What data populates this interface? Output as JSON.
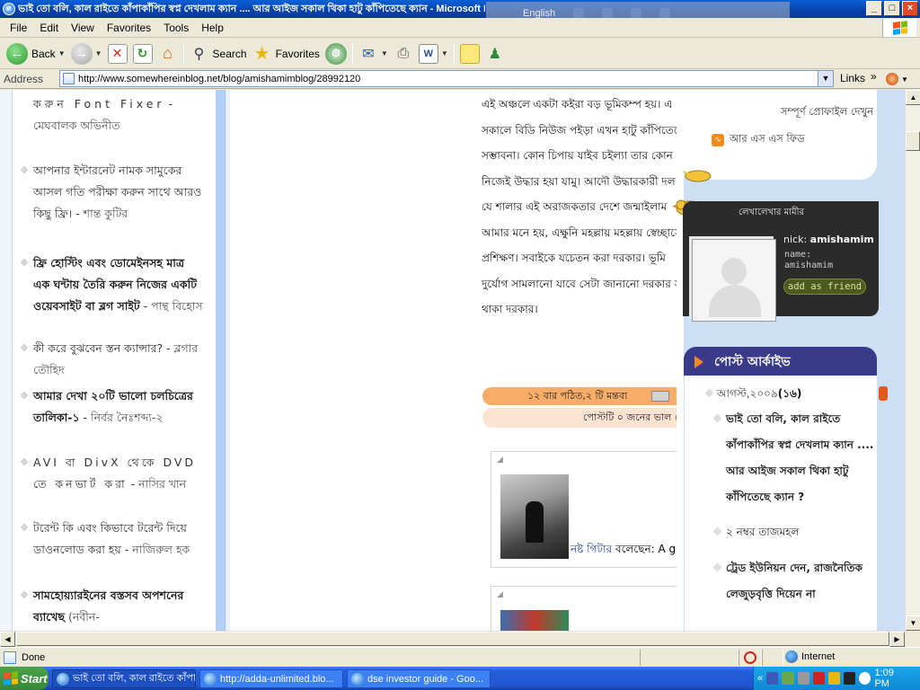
{
  "window": {
    "title": "ভাই তো বলি, কাল রাইতে কাঁপাকাঁপির স্বপ্ন দেখলাম ক্যান .... আর আইজ সকাল থিকা হাটু কাঁপিতেছে ক্যান - Microsoft Internet Explorer",
    "lang_indicator": "English",
    "buttons": {
      "minimize": "_",
      "maximize": "□",
      "close": "×"
    }
  },
  "menu": [
    "File",
    "Edit",
    "View",
    "Favorites",
    "Tools",
    "Help"
  ],
  "toolbar": {
    "back": "Back",
    "search": "Search",
    "favorites": "Favorites"
  },
  "address": {
    "label": "Address",
    "url": "http://www.somewhereinblog.net/blog/amishamimblog/28992120",
    "links": "Links"
  },
  "left_sidebar": [
    {
      "title": "করুন Font Fixer",
      "author": "মেঘবালক অভিনীত",
      "bold": false
    },
    {
      "title": "আপনার ইন্টারনেট নামক সামুকের আসল গতি পরীক্ষা করুন সাথে আরও কিছু ফ্রি।",
      "author": "শান্ত কুটির",
      "bold": false
    },
    {
      "title": "ফ্রি হোস্টিং এবং ডোমেইনসহ মাত্র এক ঘন্টায় তৈরি করুন নিজের একটি ওয়েবসাইট বা ব্লগ সাইট",
      "author": "পান্থ বিহোস",
      "bold": true
    },
    {
      "title": "কী করে বুঝবেন স্তন ক্যান্সার?",
      "author": "ব্লগার তৌহিদ",
      "bold": false
    },
    {
      "title": "আমার দেখা ২০টি ভালো চলচিত্রের তালিকা-১",
      "author": "নির্বর নৈঃশব্দ্য-২",
      "bold": true
    },
    {
      "title": "AVI বা DivX থেকে DVD তে কনভার্ট করা",
      "author": "নাসির খান",
      "bold": false
    },
    {
      "title": "টরেন্ট কি এবং কিভাবে টরেন্ট দিয়ে ডাওনলোড করা হয়",
      "author": "নাজিরুল হক",
      "bold": false
    },
    {
      "title": "সামহোয়্যারইনের বস্তসব অপশনের ব্যাখেছ",
      "author": "(নবীন-",
      "bold": true
    }
  ],
  "post": {
    "lines": [
      "এই অঞ্চলে একটা কইরা বড় ভূমিকম্প হয়। এ",
      "সকালে বিডি নিউজ পইড়া এখন হাটু কাঁপিতেছে",
      "সম্ভাবনা। কোন চিপায় যাইব চইল্যা তার কোন",
      "নিজেই উদ্ধার হয়া যামু। আদৌ উদ্ধারকারী দল",
      "যে শালার এই অরাজকতার দেশে জন্মাইলাম",
      "আমার মনে হয়, এক্ষুনি মহল্লায় মহল্লায় স্বেচ্ছাসে",
      "প্রশিক্ষণ। সবাইকে যচেতন করা দরকার। ভূমি",
      "দুর্যোগ সামলানো যাবে সেটা জানানো দরকার স",
      "থাকা দরকার।"
    ],
    "stats": "১২ বার পঠিত,২ টি মন্তব্য",
    "likes": "পোস্টটি ০ জনের ভাল লে"
  },
  "comments": [
    {
      "commenter": "নষ্ট গিটার",
      "said": "বলেছেন:",
      "text": "A g"
    }
  ],
  "profile": {
    "full_profile": "সম্পূর্ণ প্রোফাইল দেখুন",
    "rss": "আর এস এস ফিড",
    "card_title": "লেখালেখার মামীর",
    "nick_label": "nick:",
    "nick": "amishamim",
    "name_label": "name:",
    "name": "amishamim",
    "add_friend": "add as friend"
  },
  "archive": {
    "header": "পোস্ট আর্কাইভ",
    "month": "আগস্ট,২০০৯",
    "month_count": "(১৬)",
    "items": [
      {
        "text": "ভাই তো বলি, কাল রাইতে কাঁপাকাঁপির স্বপ্ন দেখলাম ক্যান .... আর আইজ সকাল থিকা হাটু কাঁপিতেছে ক্যান ?",
        "bold": true
      },
      {
        "text": "২ নম্বর তাজমহল",
        "bold": false
      },
      {
        "text": "ট্রেড ইউনিয়ন দেন, রাজনৈতিক লেজুড়বৃত্তি দিয়েন না",
        "bold": true
      }
    ]
  },
  "status": {
    "text": "Done",
    "zone": "Internet"
  },
  "taskbar": {
    "start": "Start",
    "tasks": [
      "ভাই তো বলি, কাল রাইতে কাঁপাকাঁপির...",
      "http://adda-unlimited.blo...",
      "dse investor guide - Goo..."
    ],
    "clock": "1:09 PM"
  },
  "colors": {
    "title_bar": "#0842a8",
    "taskbar": "#245edb",
    "sidebar_blue": "#b3cff3",
    "right_column": "#ccdff5",
    "stats_bar": "#f7ad67",
    "archive_header": "#3a3a8a"
  }
}
